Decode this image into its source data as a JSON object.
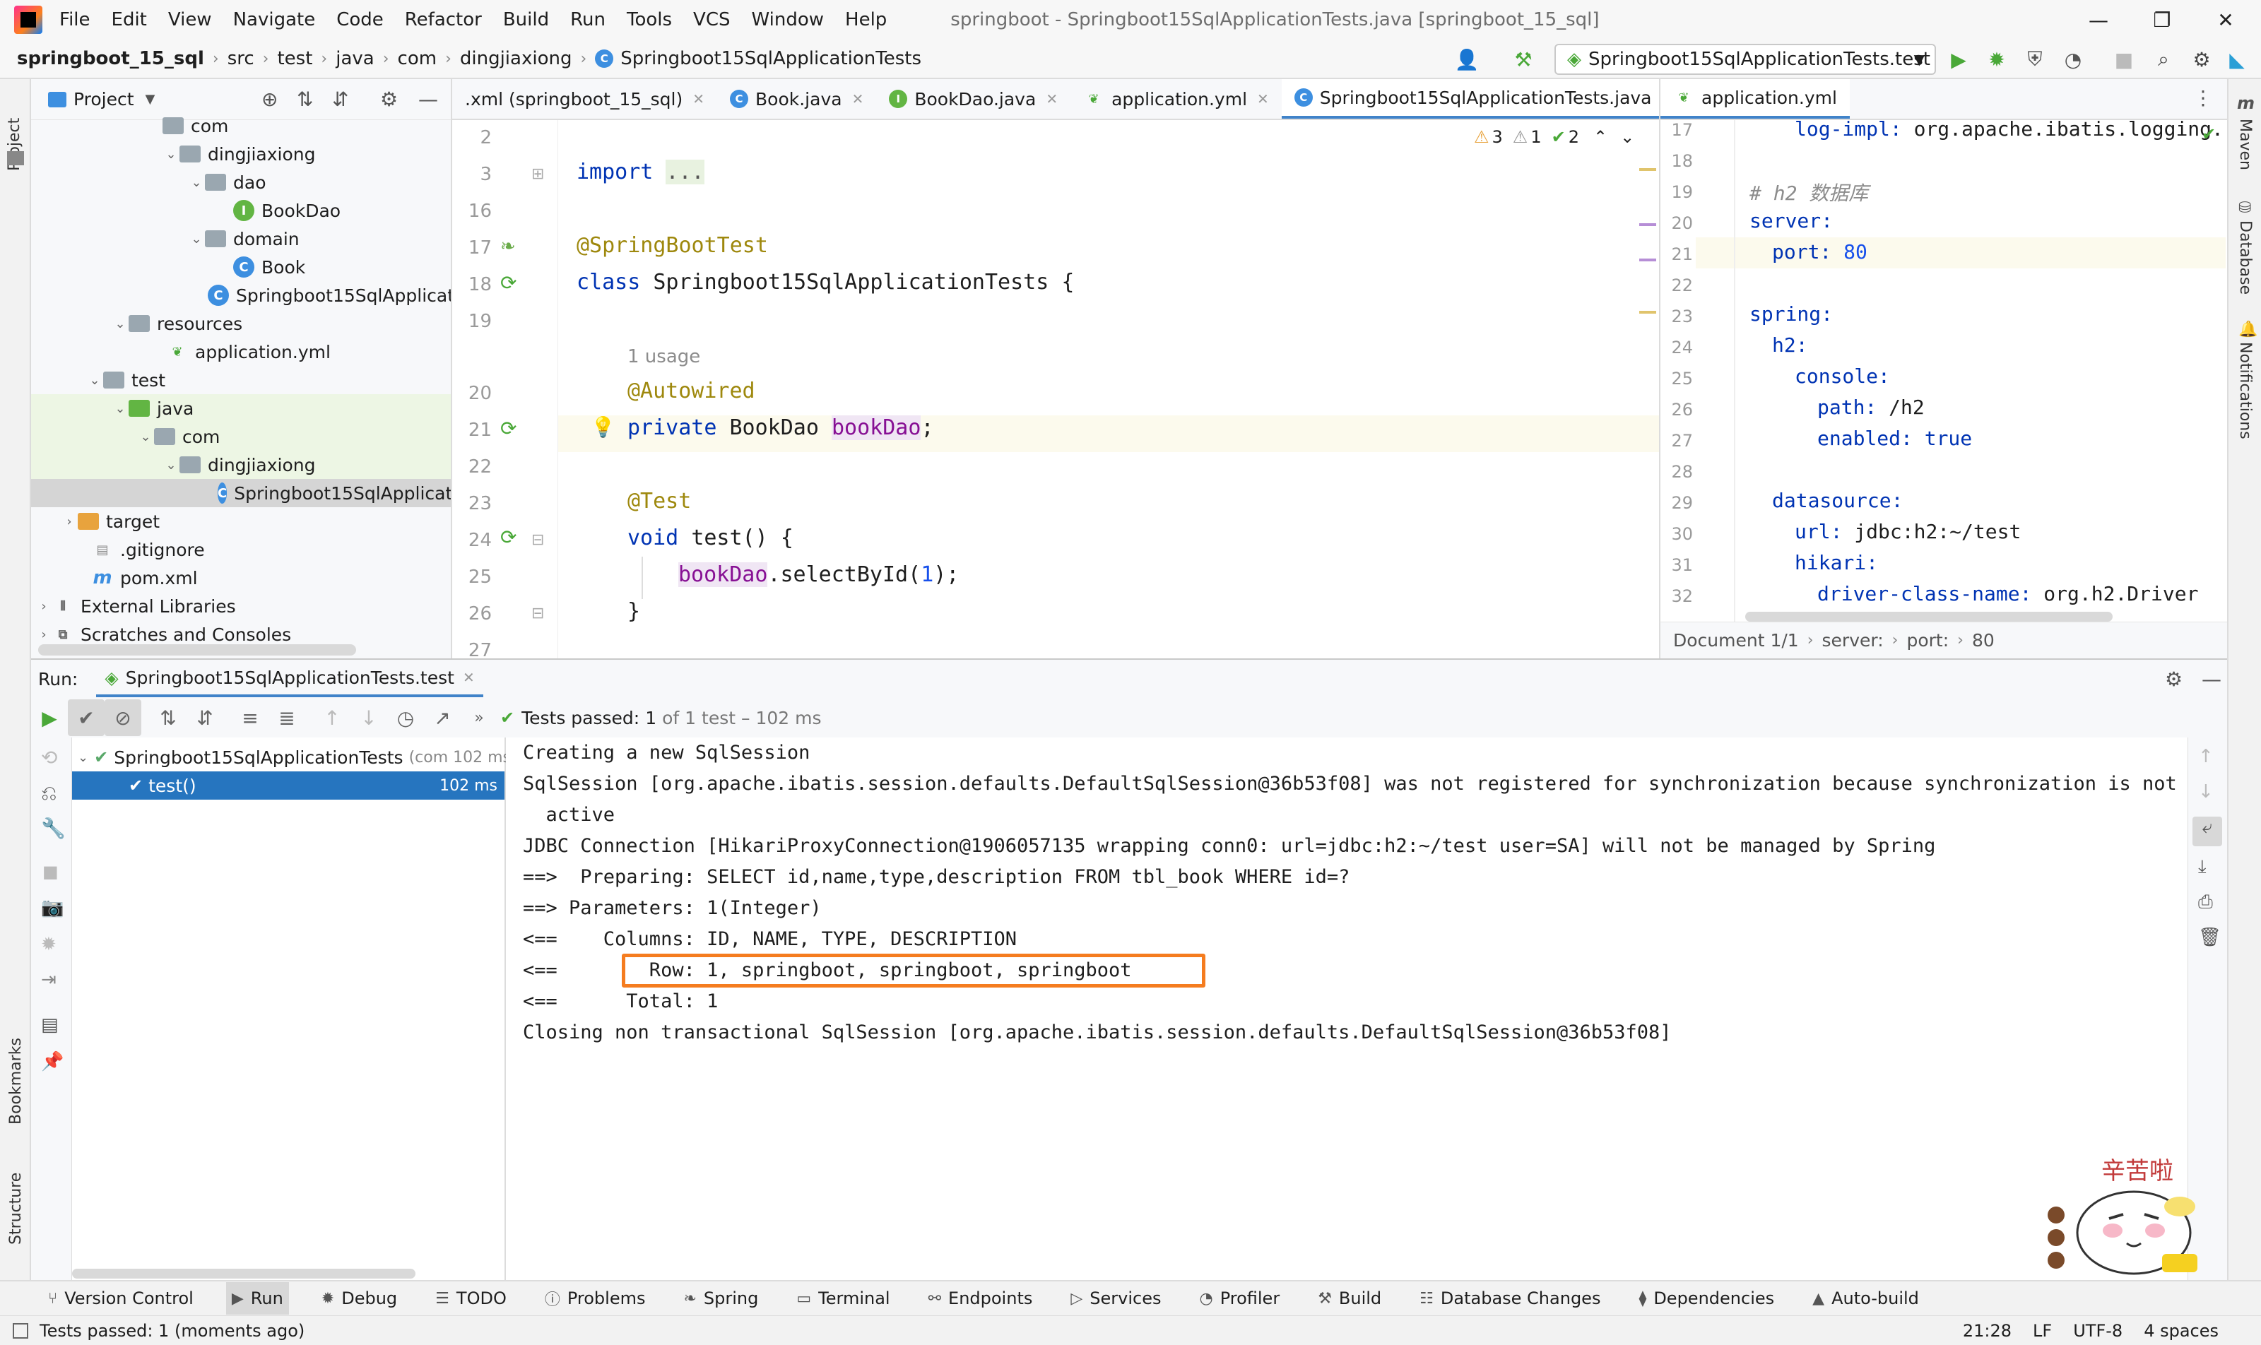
{
  "menu": {
    "items": [
      "File",
      "Edit",
      "View",
      "Navigate",
      "Code",
      "Refactor",
      "Build",
      "Run",
      "Tools",
      "VCS",
      "Window",
      "Help"
    ],
    "title": "springboot - Springboot15SqlApplicationTests.java [springboot_15_sql]"
  },
  "breadcrumb": [
    "springboot_15_sql",
    "src",
    "test",
    "java",
    "com",
    "dingjiaxiong",
    "Springboot15SqlApplicationTests"
  ],
  "run_config": "Springboot15SqlApplicationTests.test",
  "project": {
    "header": "Project",
    "items": [
      {
        "label": "com",
        "depth": 4
      },
      {
        "label": "dingjiaxiong",
        "depth": 5
      },
      {
        "label": "dao",
        "depth": 6
      },
      {
        "label": "BookDao",
        "depth": 7
      },
      {
        "label": "domain",
        "depth": 6
      },
      {
        "label": "Book",
        "depth": 7
      },
      {
        "label": "Springboot15SqlApplicati",
        "depth": 6
      },
      {
        "label": "resources",
        "depth": 3
      },
      {
        "label": "application.yml",
        "depth": 4
      },
      {
        "label": "test",
        "depth": 2
      },
      {
        "label": "java",
        "depth": 3
      },
      {
        "label": "com",
        "depth": 4
      },
      {
        "label": "dingjiaxiong",
        "depth": 5
      },
      {
        "label": "Springboot15SqlApplicati",
        "depth": 6
      },
      {
        "label": "target",
        "depth": 1
      },
      {
        "label": ".gitignore",
        "depth": 1
      },
      {
        "label": "pom.xml",
        "depth": 1
      },
      {
        "label": "External Libraries",
        "depth": 0
      },
      {
        "label": "Scratches and Consoles",
        "depth": 0
      }
    ]
  },
  "editor_tabs": [
    {
      "label": ".xml (springboot_15_sql)"
    },
    {
      "label": "Book.java"
    },
    {
      "label": "BookDao.java"
    },
    {
      "label": "application.yml"
    },
    {
      "label": "Springboot15SqlApplicationTests.java"
    }
  ],
  "inspections": {
    "warn": "3",
    "weak": "1",
    "ok": "2"
  },
  "editor": {
    "line_numbers": [
      "2",
      "3",
      "16",
      "17",
      "18",
      "19",
      "",
      "20",
      "21",
      "22",
      "23",
      "24",
      "25",
      "26",
      "27"
    ],
    "import_kw": "import",
    "import_fold": "...",
    "ann_springboottest": "@SpringBootTest",
    "class_kw": "class",
    "class_name": "Springboot15SqlApplicationTests {",
    "usage": "1 usage",
    "ann_autowired": "@Autowired",
    "private_kw": "private",
    "type_bookdao": "BookDao",
    "field_bookdao": "bookDao",
    "semi": ";",
    "ann_test": "@Test",
    "void_kw": "void",
    "method_sig": "test() {",
    "call_field": "bookDao",
    "call_method": ".selectById(",
    "call_arg": "1",
    "call_end": ");",
    "close_brace": "}"
  },
  "yml_tab": "application.yml",
  "yml": {
    "line_numbers": [
      "17",
      "18",
      "19",
      "20",
      "21",
      "22",
      "23",
      "24",
      "25",
      "26",
      "27",
      "28",
      "29",
      "30",
      "31",
      "32"
    ],
    "l17_key": "log-impl:",
    "l17_val": " org.apache.ibatis.logging.",
    "l19_cmt": "# h2 数据库",
    "l20_key": "server:",
    "l21_key": "port:",
    "l21_val": " 80",
    "l23_key": "spring:",
    "l24_key": "h2:",
    "l25_key": "console:",
    "l26_key": "path:",
    "l26_val": " /h2",
    "l27_key": "enabled:",
    "l27_val": " true",
    "l29_key": "datasource:",
    "l30_key": "url:",
    "l30_val": " jdbc:h2:~/test",
    "l31_key": "hikari:",
    "l32_key": "driver-class-name:",
    "l32_val": " org.h2.Driver"
  },
  "yml_breadcrumb": [
    "Document 1/1",
    "server:",
    "port:",
    "80"
  ],
  "run": {
    "label": "Run:",
    "tab": "Springboot15SqlApplicationTests.test",
    "status_prefix": "Tests passed:",
    "status_count": "1",
    "status_suffix": "of 1 test – 102 ms",
    "tree_root": "Springboot15SqlApplicationTests",
    "tree_root_meta": "(com 102 ms",
    "tree_child": "test()",
    "tree_child_time": "102 ms"
  },
  "console": [
    "Creating a new SqlSession",
    "SqlSession [org.apache.ibatis.session.defaults.DefaultSqlSession@36b53f08] was not registered for synchronization because synchronization is not",
    "  active",
    "JDBC Connection [HikariProxyConnection@1906057135 wrapping conn0: url=jdbc:h2:~/test user=SA] will not be managed by Spring",
    "==>  Preparing: SELECT id,name,type,description FROM tbl_book WHERE id=?",
    "==> Parameters: 1(Integer)",
    "<==    Columns: ID, NAME, TYPE, DESCRIPTION",
    "<==        Row: 1, springboot, springboot, springboot",
    "<==      Total: 1",
    "Closing non transactional SqlSession [org.apache.ibatis.session.defaults.DefaultSqlSession@36b53f08]"
  ],
  "bottom_tabs": [
    "Version Control",
    "Run",
    "Debug",
    "TODO",
    "Problems",
    "Spring",
    "Terminal",
    "Endpoints",
    "Services",
    "Profiler",
    "Build",
    "Database Changes",
    "Dependencies",
    "Auto-build"
  ],
  "status": {
    "message": "Tests passed: 1 (moments ago)",
    "position": "21:28",
    "line_sep": "LF",
    "encoding": "UTF-8",
    "indent": "4 spaces"
  },
  "side_tools": {
    "project": "Project",
    "bookmarks": "Bookmarks",
    "structure": "Structure",
    "maven": "Maven",
    "database": "Database",
    "notifications": "Notifications"
  },
  "sticker_text": "辛苦啦",
  "colors": {
    "accent": "#4083c9",
    "highlight_box": "#f57c1f",
    "selection": "#2675bf",
    "pass": "#59a869"
  }
}
